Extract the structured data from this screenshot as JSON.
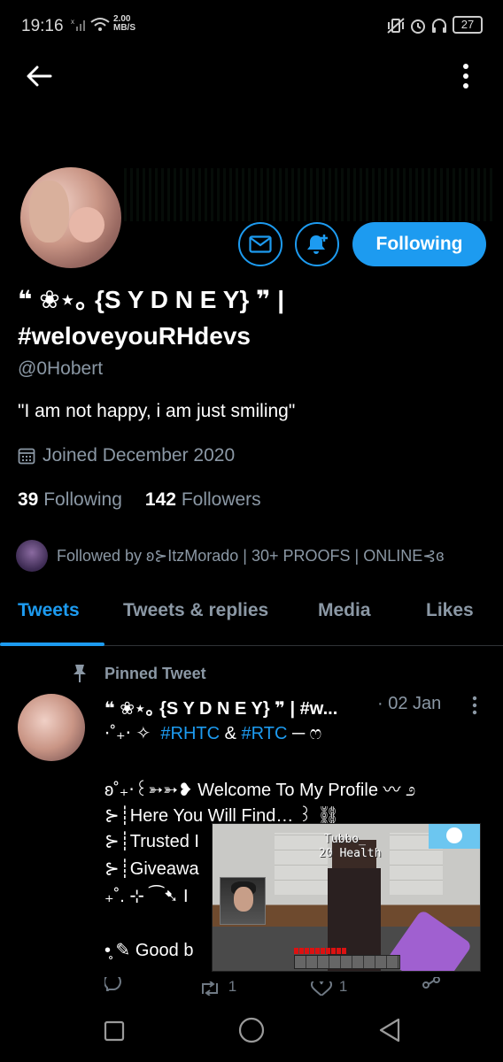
{
  "status_bar": {
    "time": "19:16",
    "net_speed_value": "2.00",
    "net_speed_unit": "MB/S",
    "battery": "27"
  },
  "profile": {
    "name": "❝ ❀⋆｡ {S Y D N E Y} ❞ | #weloveyouRHdevs",
    "handle": "@0Hobert",
    "bio": "\"I am not happy, i am just smiling\"",
    "joined": "Joined December 2020",
    "following_count": "39",
    "following_label": "Following",
    "followers_count": "142",
    "followers_label": "Followers",
    "followed_by": "Followed by ʚ⊱ItzMorado | 30+ PROOFS | ONLINE⊰ɞ",
    "follow_button_label": "Following"
  },
  "tabs": [
    {
      "label": "Tweets",
      "active": true
    },
    {
      "label": "Tweets & replies",
      "active": false
    },
    {
      "label": "Media",
      "active": false
    },
    {
      "label": "Likes",
      "active": false
    }
  ],
  "pinned_tweet": {
    "pinned_label": "Pinned Tweet",
    "author": "❝ ❀⋆｡ {S Y D N E Y} ❞ | #w...",
    "date": "· 02 Jan",
    "line1_prefix": "⋅˚₊‧ ✧",
    "line1_tag1": "#RHTC",
    "line1_amp": "&",
    "line1_tag2": "#RTC",
    "line1_suffix": "─ ෆ",
    "line2": "ʚ˚₊‧꒰➳➳❥ Welcome To My Profile 〰 ೨",
    "line3": "⊱┊Here You Will Find… ꒱ ⛓",
    "line4": "⊱┊Trusted I",
    "line5": "⊱┊Giveawa",
    "line6": "₊˚. ⊹ ⁀➷ I",
    "line7": "•̥ ✎ Good b",
    "retweet_count": "1",
    "like_count": "1"
  },
  "video_overlay": {
    "player_name": "Tubbo_",
    "health": "20 Health"
  },
  "colors": {
    "accent": "#1d9bf0",
    "background": "#000000",
    "secondary_text": "#8b98a5"
  },
  "icons": [
    "back-arrow-icon",
    "more-vertical-icon",
    "mail-icon",
    "bell-plus-icon",
    "calendar-icon",
    "pin-icon",
    "reply-icon",
    "retweet-icon",
    "like-icon",
    "share-icon",
    "nav-square-icon",
    "nav-circle-icon",
    "nav-triangle-icon"
  ]
}
